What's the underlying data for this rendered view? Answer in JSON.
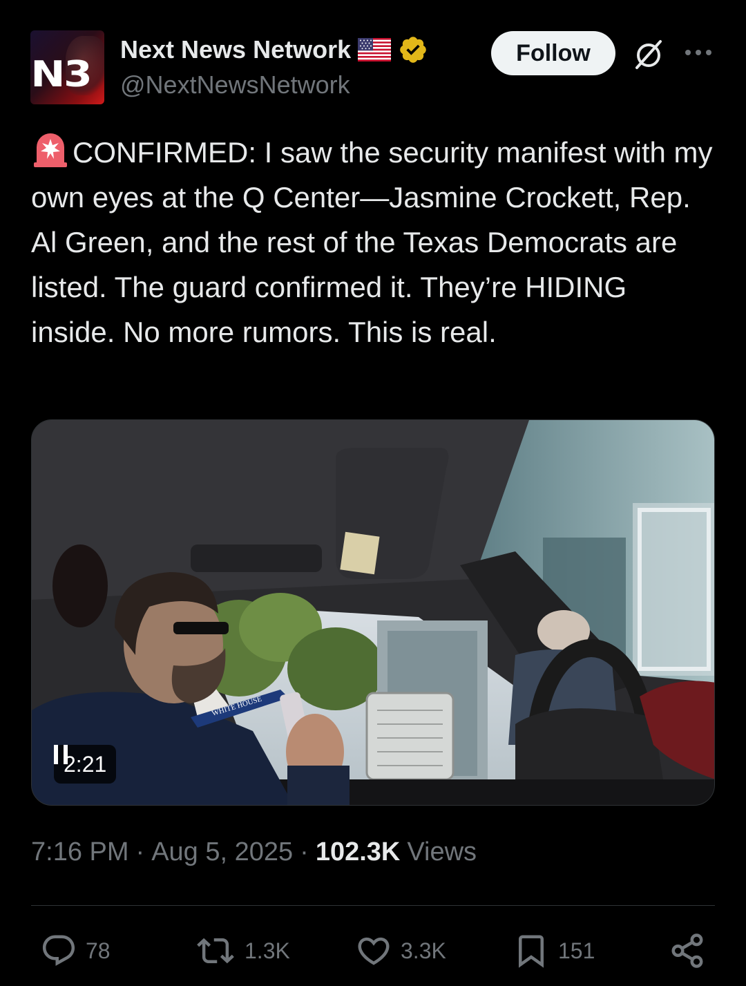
{
  "author": {
    "display_name": "Next News Network",
    "handle": "@NextNewsNetwork",
    "avatar_text": "N3"
  },
  "follow_label": "Follow",
  "tweet": {
    "text": "CONFIRMED: I saw the security manifest with my own eyes at the Q Center—Jasmine Crockett, Rep. Al Green, and the rest of the Texas Democrats are listed. The guard confirmed it. They’re HIDING inside. No more rumors. This is real."
  },
  "video": {
    "time_remaining": "2:21",
    "lanyard_text": "WHITE HOUSE"
  },
  "meta": {
    "time": "7:16 PM",
    "separator": "·",
    "date": "Aug 5, 2025",
    "views_count": "102.3K",
    "views_label": "Views"
  },
  "actions": {
    "replies": "78",
    "reposts": "1.3K",
    "likes": "3.3K",
    "bookmarks": "151"
  },
  "icons": [
    "siren-emoji-icon",
    "us-flag-icon",
    "verified-badge-icon",
    "grok-icon",
    "more-icon",
    "pause-icon",
    "reply-icon",
    "repost-icon",
    "like-icon",
    "bookmark-icon",
    "share-icon"
  ],
  "colors": {
    "background": "#000000",
    "text_primary": "#e7e9ea",
    "text_secondary": "#71767b",
    "verified_gold": "#e2b719",
    "follow_bg": "#eff3f4"
  }
}
